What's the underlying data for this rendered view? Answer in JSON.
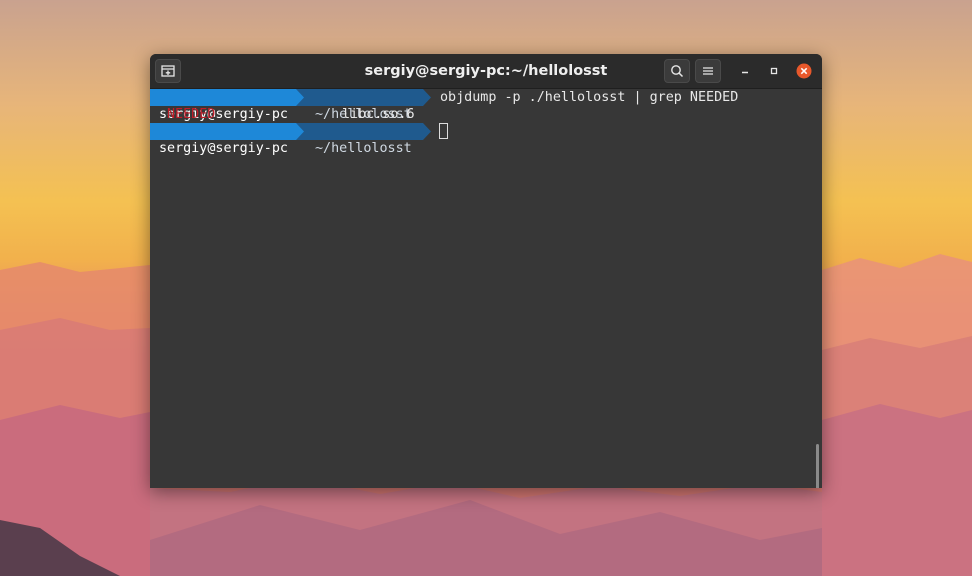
{
  "window": {
    "title": "sergiy@sergiy-pc:~/hellolosst",
    "colors": {
      "background": "#373737",
      "titlebar": "#2b2b2b",
      "close_button": "#e8582b"
    },
    "icons": {
      "new_tab": "new-tab-icon",
      "search": "search-icon",
      "menu": "hamburger-menu-icon",
      "minimize": "minimize-icon",
      "maximize": "maximize-icon",
      "close": "close-icon"
    }
  },
  "terminal": {
    "prompt_colors": {
      "user_segment": "#1e88d8",
      "dir_segment": "#1f5a8e"
    },
    "lines": [
      {
        "user": "sergiy@sergiy-pc",
        "dir": "~/hellolosst",
        "command": "objdump -p ./hellolosst | grep NEEDED"
      },
      {
        "match": "NEEDED",
        "rest": "libc.so.6",
        "match_color": "#c01c28"
      },
      {
        "user": "sergiy@sergiy-pc",
        "dir": "~/hellolosst",
        "command": ""
      }
    ]
  }
}
